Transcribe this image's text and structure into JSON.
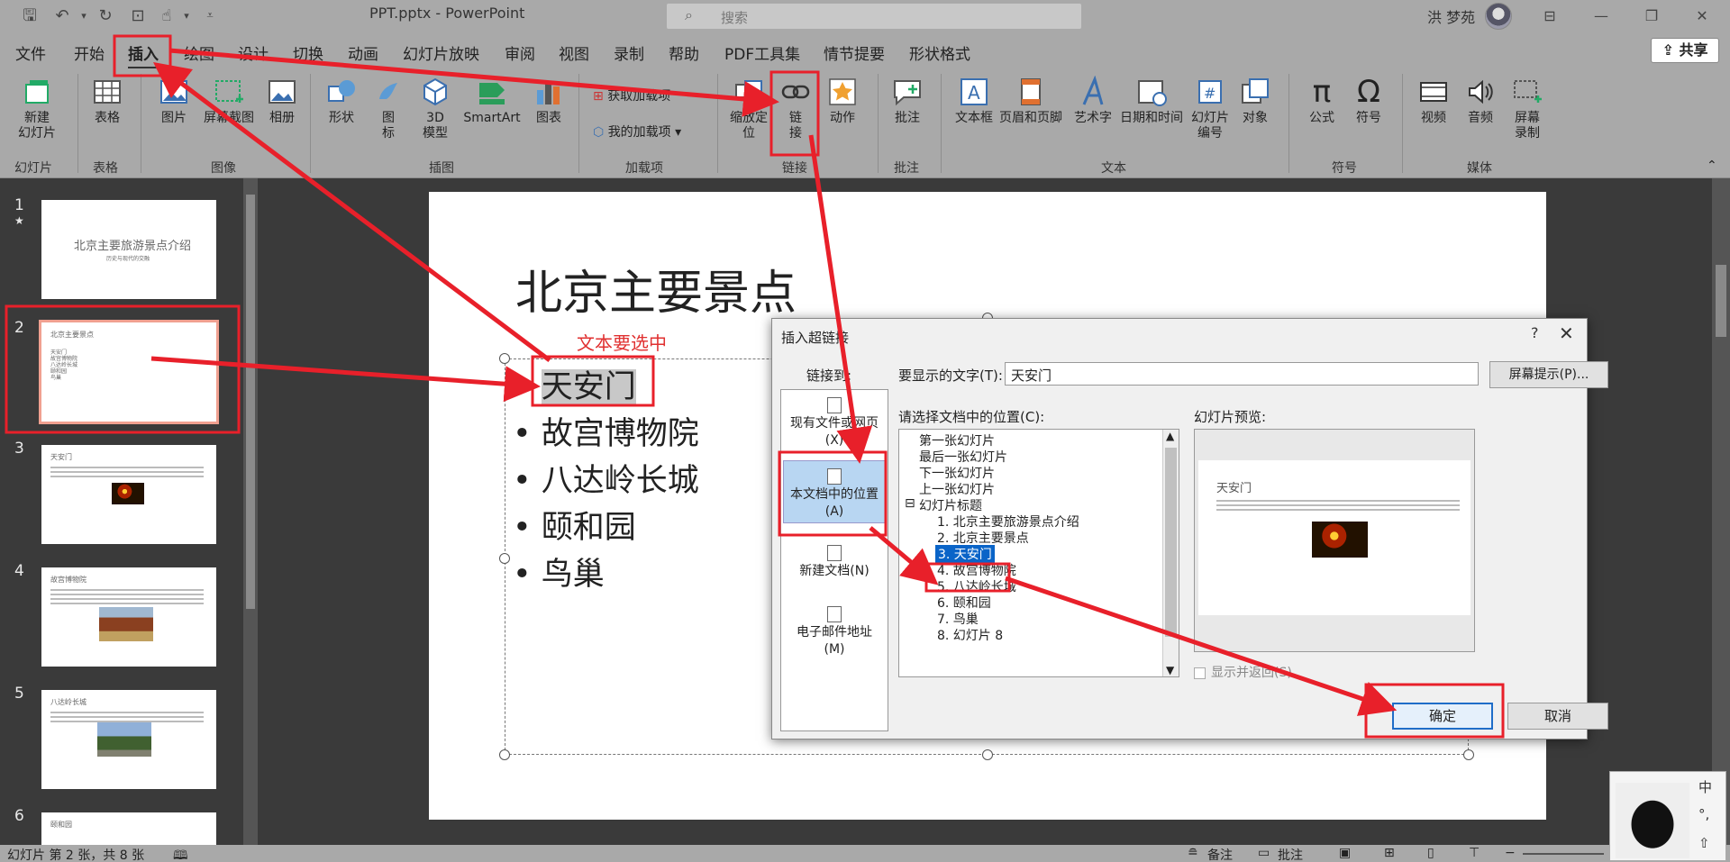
{
  "window": {
    "doc_title": "PPT.pptx  -  PowerPoint",
    "search_placeholder": "搜索",
    "user_name": "洪 梦苑"
  },
  "menu": {
    "tabs": [
      "文件",
      "开始",
      "插入",
      "绘图",
      "设计",
      "切换",
      "动画",
      "幻灯片放映",
      "审阅",
      "视图",
      "录制",
      "帮助",
      "PDF工具集",
      "情节提要",
      "形状格式"
    ],
    "share_label": "共享"
  },
  "ribbon": {
    "new_slide": "新建\n幻灯片",
    "table": "表格",
    "picture": "图片",
    "screenshot": "屏幕截图",
    "album": "相册",
    "shapes": "形状",
    "icons": "图\n标",
    "model3d": "3D\n模型",
    "smartart": "SmartArt",
    "chart": "图表",
    "get_addins": "获取加载项",
    "my_addins": "我的加载项",
    "zoom": "缩放定\n位",
    "link": "链\n接",
    "action": "动作",
    "comment": "批注",
    "textbox": "文本框",
    "header_footer": "页眉和页脚",
    "wordart": "艺术字",
    "datetime": "日期和时间",
    "slide_number": "幻灯片\n编号",
    "object": "对象",
    "equation": "公式",
    "symbol": "符号",
    "video": "视频",
    "audio": "音频",
    "screen_rec": "屏幕\n录制",
    "groups": [
      "幻灯片",
      "表格",
      "图像",
      "插图",
      "加载项",
      "链接",
      "批注",
      "文本",
      "符号",
      "媒体"
    ]
  },
  "thumbnails": {
    "numbers": [
      "1",
      "2",
      "3",
      "4",
      "5",
      "6"
    ],
    "t1_title": "北京主要旅游景点介绍",
    "t1_sub": "历史与现代的交融",
    "t2_title": "北京主要景点",
    "t2_items": [
      "天安门",
      "故宫博物院",
      "八达岭长城",
      "颐和园",
      "鸟巢"
    ],
    "t3_title": "天安门",
    "t4_title": "故宫博物院",
    "t5_title": "八达岭长城",
    "t6_title": "颐和园"
  },
  "slide": {
    "title": "北京主要景点",
    "bullets": [
      "天安门",
      "故宫博物院",
      "八达岭长城",
      "颐和园",
      "鸟巢"
    ],
    "annotation": "文本要选中"
  },
  "dialog": {
    "title": "插入超链接",
    "help": "?",
    "link_to_label": "链接到:",
    "link_to_items": [
      "现有文件或网页\n(X)",
      "本文档中的位置\n(A)",
      "新建文档(N)",
      "电子邮件地址\n(M)"
    ],
    "display_text_label": "要显示的文字(T):",
    "display_text_value": "天安门",
    "screentip_label": "屏幕提示(P)...",
    "place_label": "请选择文档中的位置(C):",
    "tree": [
      "第一张幻灯片",
      "最后一张幻灯片",
      "下一张幻灯片",
      "上一张幻灯片",
      "幻灯片标题",
      "1. 北京主要旅游景点介绍",
      "2. 北京主要景点",
      "3. 天安门",
      "4. 故宫博物院",
      "5. 八达岭长城",
      "6. 颐和园",
      "7. 鸟巢",
      "8. 幻灯片 8"
    ],
    "preview_label": "幻灯片预览:",
    "preview_title": "天安门",
    "show_return": "显示并返回(S)",
    "ok": "确定",
    "cancel": "取消"
  },
  "status": {
    "slide_info": "幻灯片 第 2 张，共 8 张",
    "notes": "备注",
    "comments": "批注"
  },
  "ime": {
    "keys": [
      "中",
      "°,",
      "⇧"
    ]
  }
}
